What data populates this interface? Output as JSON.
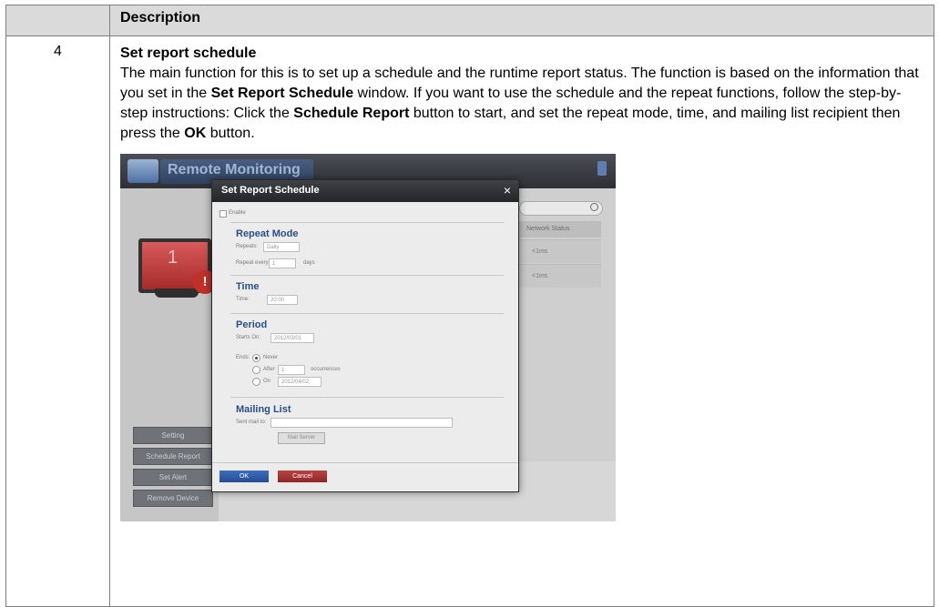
{
  "table": {
    "header_description": "Description",
    "step_number": "4",
    "section_heading": "Set report schedule",
    "paragraph": [
      {
        "text": "The main function for this is to set up a schedule and the runtime report status. The function is based on the information that you set in the ",
        "bold": false
      },
      {
        "text": "Set Report Schedule",
        "bold": true
      },
      {
        "text": " window. If you want to use the schedule and the repeat functions, follow the step-by-step instructions: Click the ",
        "bold": false
      },
      {
        "text": "Schedule Report",
        "bold": true
      },
      {
        "text": " button to start, and set the repeat mode, time, and mailing list recipient then press the ",
        "bold": false
      },
      {
        "text": "OK",
        "bold": true
      },
      {
        "text": " button.",
        "bold": false
      }
    ]
  },
  "screenshot": {
    "app_title": "Remote Monitoring",
    "monitor_number": "1",
    "alert_glyph": "!",
    "search_icon": "search-icon",
    "network_status_header": "Network Status",
    "network_status_cells": [
      "<1ms",
      "<1ms"
    ],
    "side_buttons": [
      "Setting",
      "Schedule Report",
      "Set Alert",
      "Remove Device"
    ],
    "modal": {
      "title": "Set Report Schedule",
      "close_glyph": "×",
      "enable_label": "Enable",
      "repeat_mode_heading": "Repeat Mode",
      "repeats_label": "Repeats:",
      "repeats_value": "Daily",
      "repeat_every_label": "Repeat every:",
      "repeat_every_value": "1",
      "repeat_every_unit": "days",
      "time_heading": "Time",
      "time_label": "Time:",
      "time_value": "20:00",
      "period_heading": "Period",
      "starts_on_label": "Starts On:",
      "starts_on_value": "2012/03/01",
      "ends_label": "Ends:",
      "ends_never": "Never",
      "ends_after": "After",
      "ends_after_value": "1",
      "ends_after_unit": "occurrences",
      "ends_on": "On",
      "ends_on_value": "2012/04/02",
      "mailing_list_heading": "Mailing List",
      "sent_mail_to_label": "Sent mail to:",
      "mail_server_button": "Mail Server",
      "ok_label": "OK",
      "cancel_label": "Cancel"
    }
  }
}
